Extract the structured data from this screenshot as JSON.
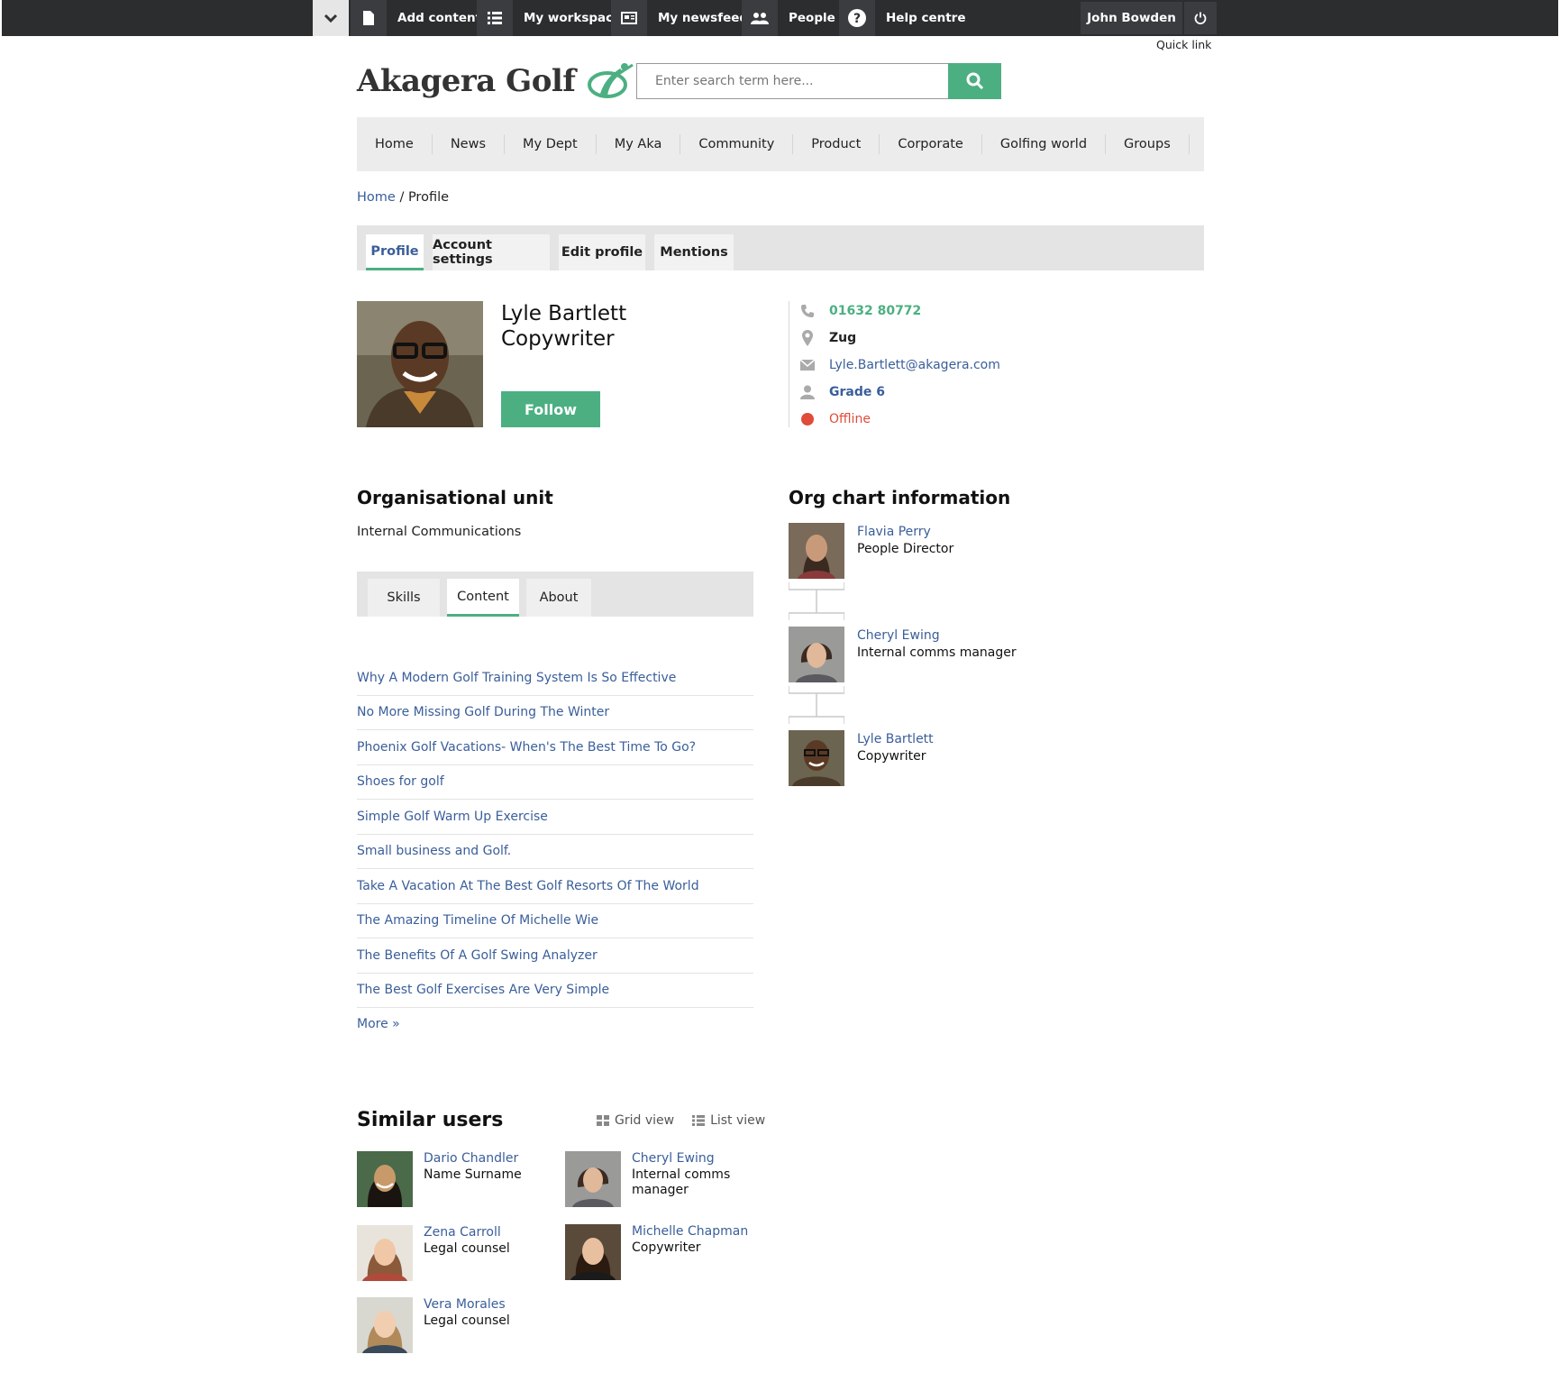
{
  "toolbar": {
    "add_content": "Add content",
    "my_workspace": "My workspace",
    "my_newsfeed": "My newsfeed",
    "people": "People",
    "help_centre": "Help centre",
    "user_name": "John Bowden",
    "quick_link": "Quick link"
  },
  "header": {
    "logo_text": "Akagera Golf",
    "search_placeholder": "Enter search term here...",
    "brand_color": "#4caf82"
  },
  "nav": {
    "items": [
      "Home",
      "News",
      "My Dept",
      "My Aka",
      "Community",
      "Product",
      "Corporate",
      "Golfing world",
      "Groups"
    ]
  },
  "breadcrumb": {
    "home": "Home",
    "separator": "/",
    "current": "Profile"
  },
  "profile_tabs": [
    "Profile",
    "Account settings",
    "Edit profile",
    "Mentions"
  ],
  "profile": {
    "name": "Lyle Bartlett",
    "role": "Copywriter",
    "follow_label": "Follow",
    "phone": "01632 80772",
    "location": "Zug",
    "email": "Lyle.Bartlett@akagera.com",
    "grade": "Grade 6",
    "status": "Offline",
    "status_color": "#e04b3a"
  },
  "org_unit": {
    "heading": "Organisational unit",
    "value": "Internal Communications"
  },
  "section_tabs": [
    "Skills",
    "Content",
    "About"
  ],
  "content_items": [
    "Why A Modern Golf Training System Is So Effective",
    "No More Missing Golf During The Winter",
    "Phoenix Golf Vacations- When's The Best Time To Go?",
    "Shoes for golf",
    "Simple Golf Warm Up Exercise",
    "Small business and Golf.",
    "Take A Vacation At The Best Golf Resorts Of The World",
    "The Amazing Timeline Of Michelle Wie",
    "The Benefits Of A Golf Swing Analyzer",
    "The Best Golf Exercises Are Very Simple"
  ],
  "more_label": "More »",
  "org_chart": {
    "heading": "Org chart information",
    "people": [
      {
        "name": "Flavia Perry",
        "role": "People Director"
      },
      {
        "name": "Cheryl Ewing",
        "role": "Internal comms manager"
      },
      {
        "name": "Lyle Bartlett",
        "role": "Copywriter"
      }
    ]
  },
  "similar_users": {
    "heading": "Similar users",
    "grid_view": "Grid view",
    "list_view": "List view",
    "users": [
      {
        "name": "Dario Chandler",
        "role": "Name Surname"
      },
      {
        "name": "Cheryl Ewing",
        "role": "Internal comms manager"
      },
      {
        "name": "Zena Carroll",
        "role": "Legal counsel"
      },
      {
        "name": "Michelle Chapman",
        "role": "Copywriter"
      },
      {
        "name": "Vera Morales",
        "role": "Legal counsel"
      }
    ]
  }
}
